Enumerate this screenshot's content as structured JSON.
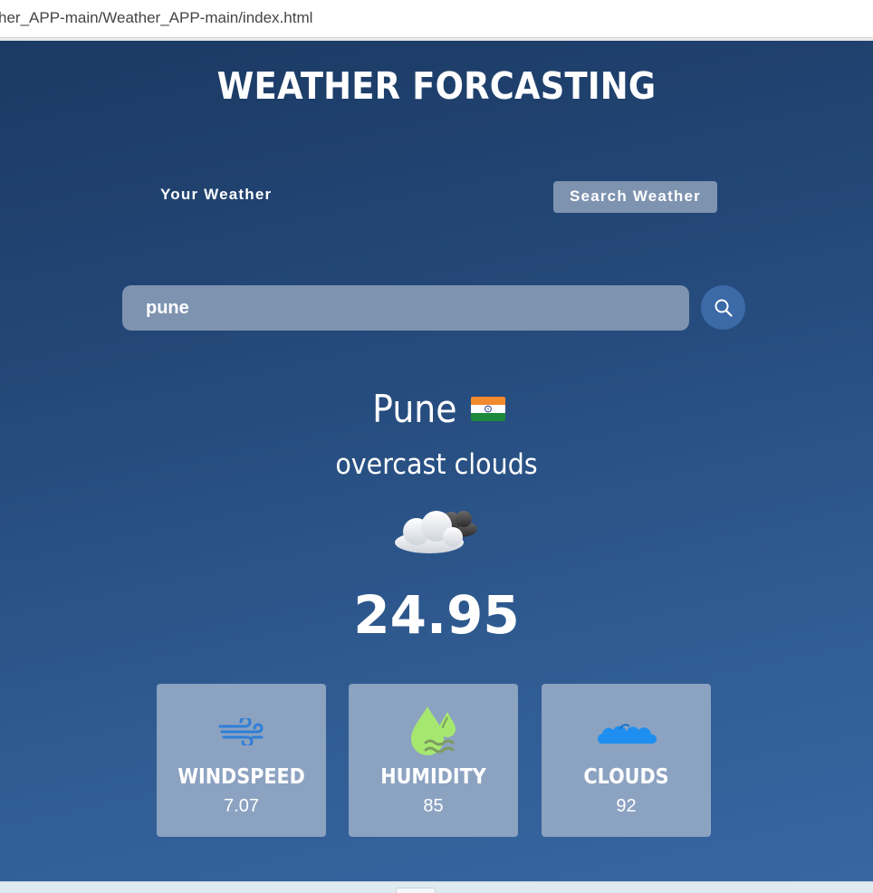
{
  "browser": {
    "address": "her_APP-main/Weather_APP-main/index.html"
  },
  "app": {
    "title": "WEATHER FORCASTING",
    "tabs": {
      "your_weather": "Your Weather",
      "search_weather": "Search Weather"
    },
    "search": {
      "value": "pune",
      "button_icon": "search-icon"
    },
    "weather": {
      "city": "Pune",
      "country_flag_icon": "india-flag-icon",
      "description": "overcast clouds",
      "condition_icon": "cloud-icon",
      "temperature": "24.95"
    },
    "cards": [
      {
        "label": "WINDSPEED",
        "value": "7.07",
        "icon": "wind-icon"
      },
      {
        "label": "HUMIDITY",
        "value": "85",
        "icon": "humidity-icon"
      },
      {
        "label": "CLOUDS",
        "value": "92",
        "icon": "clouds-icon"
      }
    ]
  },
  "colors": {
    "background_top": "#1b3a63",
    "background_bottom": "#3866a2",
    "panel": "#7e93b0",
    "card": "#8ca2c1",
    "search_button": "#3c6aa7",
    "wind_icon": "#2f7fd6",
    "humidity_icon": "#a6e86f",
    "clouds_icon": "#1e8ff0"
  }
}
